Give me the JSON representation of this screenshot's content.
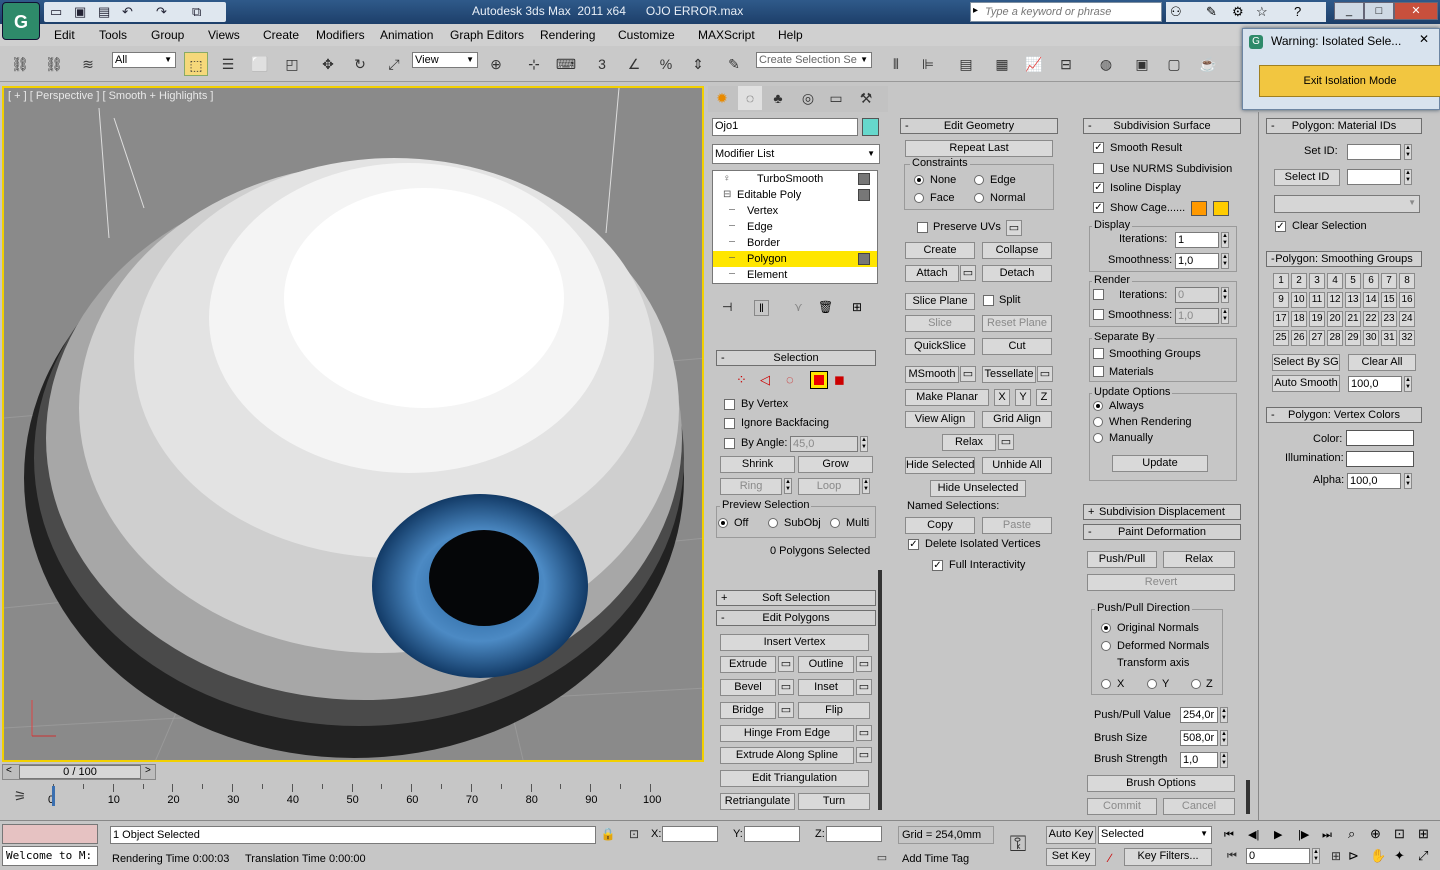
{
  "app": {
    "title": "Autodesk 3ds Max  2011 x64      OJO ERROR.max",
    "search_placeholder": "Type a keyword or phrase",
    "accent": "#ffd700"
  },
  "menu": [
    "Edit",
    "Tools",
    "Group",
    "Views",
    "Create",
    "Modifiers",
    "Animation",
    "Graph Editors",
    "Rendering",
    "Customize",
    "MAXScript",
    "Help"
  ],
  "toolbar": {
    "filter": "All",
    "refcoord": "View",
    "selset": "Create Selection Se"
  },
  "warning": {
    "title": "Warning: Isolated Sele...",
    "button": "Exit Isolation Mode"
  },
  "viewport": {
    "label": "[ + ] [ Perspective ] [ Smooth + Highlights ]"
  },
  "object": {
    "name": "Ojo1",
    "modifier_list": "Modifier List",
    "color": "#66d8cc"
  },
  "stack": [
    {
      "label": "TurboSmooth",
      "level": 0
    },
    {
      "label": "Editable Poly",
      "level": 0
    },
    {
      "label": "Vertex",
      "level": 1
    },
    {
      "label": "Edge",
      "level": 1
    },
    {
      "label": "Border",
      "level": 1
    },
    {
      "label": "Polygon",
      "level": 1,
      "selected": true
    },
    {
      "label": "Element",
      "level": 1
    }
  ],
  "selection": {
    "header": "Selection",
    "by_vertex": "By Vertex",
    "ignore_backfacing": "Ignore Backfacing",
    "by_angle": "By Angle:",
    "angle": "45,0",
    "shrink": "Shrink",
    "grow": "Grow",
    "ring": "Ring",
    "loop": "Loop",
    "preview": "Preview Selection",
    "off": "Off",
    "subobj": "SubObj",
    "multi": "Multi",
    "status": "0 Polygons Selected"
  },
  "soft_selection": "Soft Selection",
  "edit_polygons": {
    "header": "Edit Polygons",
    "insert_vertex": "Insert Vertex",
    "extrude": "Extrude",
    "outline": "Outline",
    "bevel": "Bevel",
    "inset": "Inset",
    "bridge": "Bridge",
    "flip": "Flip",
    "hinge": "Hinge From Edge",
    "extrude_spline": "Extrude Along Spline",
    "edit_tri": "Edit Triangulation",
    "retri": "Retriangulate",
    "turn": "Turn"
  },
  "edit_geometry": {
    "header": "Edit Geometry",
    "repeat_last": "Repeat Last",
    "constraints": "Constraints",
    "none": "None",
    "edge": "Edge",
    "face": "Face",
    "normal": "Normal",
    "preserve_uvs": "Preserve UVs",
    "create": "Create",
    "collapse": "Collapse",
    "attach": "Attach",
    "detach": "Detach",
    "slice_plane": "Slice Plane",
    "split": "Split",
    "slice": "Slice",
    "reset_plane": "Reset Plane",
    "quickslice": "QuickSlice",
    "cut": "Cut",
    "msmooth": "MSmooth",
    "tessellate": "Tessellate",
    "make_planar": "Make Planar",
    "x": "X",
    "y": "Y",
    "z": "Z",
    "view_align": "View Align",
    "grid_align": "Grid Align",
    "relax": "Relax",
    "hide_selected": "Hide Selected",
    "unhide_all": "Unhide All",
    "hide_unselected": "Hide Unselected",
    "named_selections": "Named Selections:",
    "copy": "Copy",
    "paste": "Paste",
    "delete_isolated": "Delete Isolated Vertices",
    "full_interactivity": "Full Interactivity"
  },
  "subdivision": {
    "header": "Subdivision Surface",
    "smooth_result": "Smooth Result",
    "use_nurms": "Use NURMS Subdivision",
    "isoline": "Isoline Display",
    "show_cage": "Show Cage......",
    "cage_color1": "#ff9900",
    "cage_color2": "#ffcc00",
    "display": "Display",
    "iterations": "Iterations:",
    "iter_val": "1",
    "smoothness": "Smoothness:",
    "smooth_val": "1,0",
    "render": "Render",
    "r_iter_val": "0",
    "r_smooth_val": "1,0",
    "separate_by": "Separate By",
    "smoothing_groups": "Smoothing Groups",
    "materials": "Materials",
    "update_options": "Update Options",
    "always": "Always",
    "when_rendering": "When Rendering",
    "manually": "Manually",
    "update": "Update"
  },
  "sub_displacement": "Subdivision Displacement",
  "paint_deformation": {
    "header": "Paint Deformation",
    "push_pull": "Push/Pull",
    "relax": "Relax",
    "revert": "Revert",
    "direction": "Push/Pull Direction",
    "original": "Original Normals",
    "deformed": "Deformed Normals",
    "transform_axis": "Transform axis",
    "x": "X",
    "y": "Y",
    "z": "Z",
    "pp_value_label": "Push/Pull Value",
    "pp_value": "254,0r",
    "brush_size_label": "Brush Size",
    "brush_size": "508,0r",
    "brush_strength_label": "Brush Strength",
    "brush_strength": "1,0",
    "brush_options": "Brush Options",
    "commit": "Commit",
    "cancel": "Cancel"
  },
  "material_ids": {
    "header": "Polygon: Material IDs",
    "set_id": "Set ID:",
    "select_id": "Select ID",
    "clear_selection": "Clear Selection"
  },
  "smoothing_groups": {
    "header": "Polygon: Smoothing Groups",
    "numbers": [
      "1",
      "2",
      "3",
      "4",
      "5",
      "6",
      "7",
      "8",
      "9",
      "10",
      "11",
      "12",
      "13",
      "14",
      "15",
      "16",
      "17",
      "18",
      "19",
      "20",
      "21",
      "22",
      "23",
      "24",
      "25",
      "26",
      "27",
      "28",
      "29",
      "30",
      "31",
      "32"
    ],
    "select_by_sg": "Select By SG",
    "clear_all": "Clear All",
    "auto_smooth": "Auto Smooth",
    "auto_val": "100,0"
  },
  "vertex_colors": {
    "header": "Polygon: Vertex Colors",
    "color": "Color:",
    "illumination": "Illumination:",
    "alpha": "Alpha:",
    "alpha_val": "100,0"
  },
  "timeline": {
    "frame": "0 / 100",
    "ticks": [
      "0",
      "10",
      "20",
      "30",
      "40",
      "50",
      "60",
      "70",
      "80",
      "90",
      "100"
    ]
  },
  "status": {
    "maxscript": "Welcome to M:",
    "selected": "1 Object Selected",
    "render_time": "Rendering Time  0:00:03",
    "translation_time": "Translation Time  0:00:00",
    "x": "X:",
    "y": "Y:",
    "z": "Z:",
    "grid": "Grid = 254,0mm",
    "add_time_tag": "Add Time Tag",
    "auto_key": "Auto Key",
    "set_key": "Set Key",
    "key_mode": "Selected",
    "key_filters": "Key Filters...",
    "frame": "0"
  }
}
